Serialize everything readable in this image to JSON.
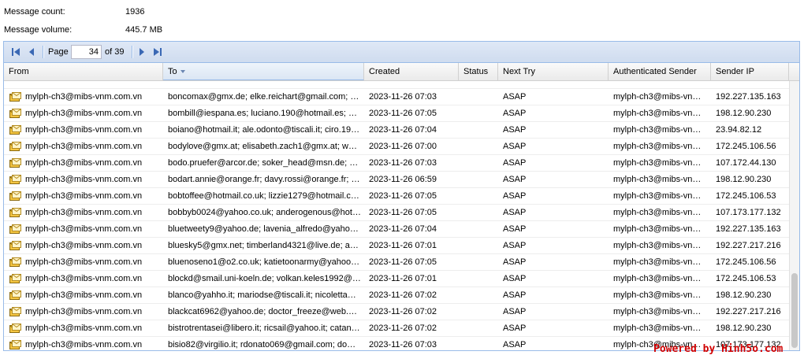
{
  "summary": {
    "count_label": "Message count:",
    "count_value": "1936",
    "volume_label": "Message volume:",
    "volume_value": "445.7 MB"
  },
  "pager": {
    "page_label": "Page",
    "current_page": "34",
    "of_label": "of 39"
  },
  "columns": [
    "From",
    "To",
    "Created",
    "Status",
    "Next Try",
    "Authenticated Sender",
    "Sender IP"
  ],
  "sorted_column": "To",
  "rows": [
    {
      "from": "mylph-ch3@mibs-vnm.com.vn",
      "to": "boncomax@gmx.de; elke.reichart@gmail.com; …",
      "created": "2023-11-26 07:03",
      "status": "",
      "next": "ASAP",
      "auth": "mylph-ch3@mibs-vn…",
      "ip": "192.227.135.163"
    },
    {
      "from": "mylph-ch3@mibs-vnm.com.vn",
      "to": "bombill@iespana.es; luciano.190@hotmail.es; …",
      "created": "2023-11-26 07:05",
      "status": "",
      "next": "ASAP",
      "auth": "mylph-ch3@mibs-vn…",
      "ip": "198.12.90.230"
    },
    {
      "from": "mylph-ch3@mibs-vnm.com.vn",
      "to": "boiano@hotmail.it; ale.odonto@tiscali.it; ciro.19…",
      "created": "2023-11-26 07:04",
      "status": "",
      "next": "ASAP",
      "auth": "mylph-ch3@mibs-vn…",
      "ip": "23.94.82.12"
    },
    {
      "from": "mylph-ch3@mibs-vnm.com.vn",
      "to": "bodylove@gmx.at; elisabeth.zach1@gmx.at; w…",
      "created": "2023-11-26 07:00",
      "status": "",
      "next": "ASAP",
      "auth": "mylph-ch3@mibs-vn…",
      "ip": "172.245.106.56"
    },
    {
      "from": "mylph-ch3@mibs-vnm.com.vn",
      "to": "bodo.pruefer@arcor.de; soker_head@msn.de; …",
      "created": "2023-11-26 07:03",
      "status": "",
      "next": "ASAP",
      "auth": "mylph-ch3@mibs-vn…",
      "ip": "107.172.44.130"
    },
    {
      "from": "mylph-ch3@mibs-vnm.com.vn",
      "to": "bodart.annie@orange.fr; davy.rossi@orange.fr; …",
      "created": "2023-11-26 06:59",
      "status": "",
      "next": "ASAP",
      "auth": "mylph-ch3@mibs-vn…",
      "ip": "198.12.90.230"
    },
    {
      "from": "mylph-ch3@mibs-vnm.com.vn",
      "to": "bobtoffee@hotmail.co.uk; lizzie1279@hotmail.c…",
      "created": "2023-11-26 07:05",
      "status": "",
      "next": "ASAP",
      "auth": "mylph-ch3@mibs-vn…",
      "ip": "172.245.106.53"
    },
    {
      "from": "mylph-ch3@mibs-vnm.com.vn",
      "to": "bobbyb0024@yahoo.co.uk; anderogenous@hot…",
      "created": "2023-11-26 07:05",
      "status": "",
      "next": "ASAP",
      "auth": "mylph-ch3@mibs-vn…",
      "ip": "107.173.177.132"
    },
    {
      "from": "mylph-ch3@mibs-vnm.com.vn",
      "to": "bluetweety9@yahoo.de; lavenia_alfredo@yaho…",
      "created": "2023-11-26 07:04",
      "status": "",
      "next": "ASAP",
      "auth": "mylph-ch3@mibs-vn…",
      "ip": "192.227.135.163"
    },
    {
      "from": "mylph-ch3@mibs-vnm.com.vn",
      "to": "bluesky5@gmx.net; timberland4321@live.de; a…",
      "created": "2023-11-26 07:01",
      "status": "",
      "next": "ASAP",
      "auth": "mylph-ch3@mibs-vn…",
      "ip": "192.227.217.216"
    },
    {
      "from": "mylph-ch3@mibs-vnm.com.vn",
      "to": "bluenoseno1@o2.co.uk; katietoonarmy@yahoo…",
      "created": "2023-11-26 07:05",
      "status": "",
      "next": "ASAP",
      "auth": "mylph-ch3@mibs-vn…",
      "ip": "172.245.106.56"
    },
    {
      "from": "mylph-ch3@mibs-vnm.com.vn",
      "to": "blockd@smail.uni-koeln.de; volkan.keles1992@…",
      "created": "2023-11-26 07:01",
      "status": "",
      "next": "ASAP",
      "auth": "mylph-ch3@mibs-vn…",
      "ip": "172.245.106.53"
    },
    {
      "from": "mylph-ch3@mibs-vnm.com.vn",
      "to": "blanco@yahho.it; mariodse@tiscali.it; nicoletta…",
      "created": "2023-11-26 07:02",
      "status": "",
      "next": "ASAP",
      "auth": "mylph-ch3@mibs-vn…",
      "ip": "198.12.90.230"
    },
    {
      "from": "mylph-ch3@mibs-vnm.com.vn",
      "to": "blackcat6962@yahoo.de; doctor_freeze@web.…",
      "created": "2023-11-26 07:02",
      "status": "",
      "next": "ASAP",
      "auth": "mylph-ch3@mibs-vn…",
      "ip": "192.227.217.216"
    },
    {
      "from": "mylph-ch3@mibs-vnm.com.vn",
      "to": "bistrotrentasei@libero.it; ricsail@yahoo.it; catan…",
      "created": "2023-11-26 07:02",
      "status": "",
      "next": "ASAP",
      "auth": "mylph-ch3@mibs-vn…",
      "ip": "198.12.90.230"
    },
    {
      "from": "mylph-ch3@mibs-vnm.com.vn",
      "to": "bisio82@virgilio.it; rdonato069@gmail.com; do…",
      "created": "2023-11-26 07:03",
      "status": "",
      "next": "ASAP",
      "auth": "mylph-ch3@mibs-vn…",
      "ip": "107.173.177.132"
    }
  ],
  "row_icon": "mail-queue-icon",
  "watermark": "Powered by Hinh5o.com",
  "colors": {
    "border": "#99bbe8",
    "toolbar": "#dfe8f6",
    "watermark": "#d00000"
  }
}
